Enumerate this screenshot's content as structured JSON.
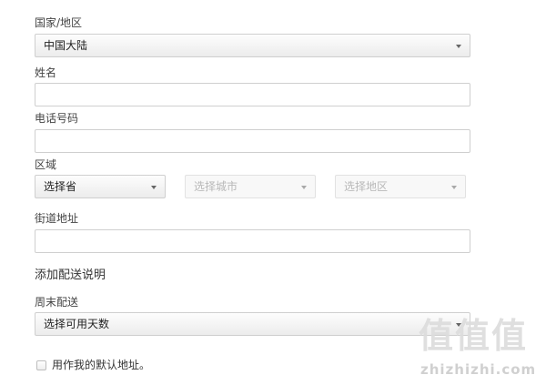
{
  "form": {
    "country": {
      "label": "国家/地区",
      "value": "中国大陆"
    },
    "name": {
      "label": "姓名",
      "value": ""
    },
    "phone": {
      "label": "电话号码",
      "value": ""
    },
    "region": {
      "label": "区域",
      "province": "选择省",
      "city": "选择城市",
      "district": "选择地区"
    },
    "street": {
      "label": "街道地址",
      "value": ""
    },
    "delivery_section": "添加配送说明",
    "weekend": {
      "label": "周末配送",
      "value": "选择可用天数"
    },
    "default_address": {
      "label": "用作我的默认地址。",
      "checked": false
    }
  },
  "watermark": {
    "logo": "值值值",
    "url": "zhizhizhi.com"
  },
  "colors": {
    "border": "#cfcfcf",
    "text": "#333333",
    "disabled_text": "#b8b8b8"
  },
  "icons": {
    "dropdown": "chevron-down-icon"
  }
}
